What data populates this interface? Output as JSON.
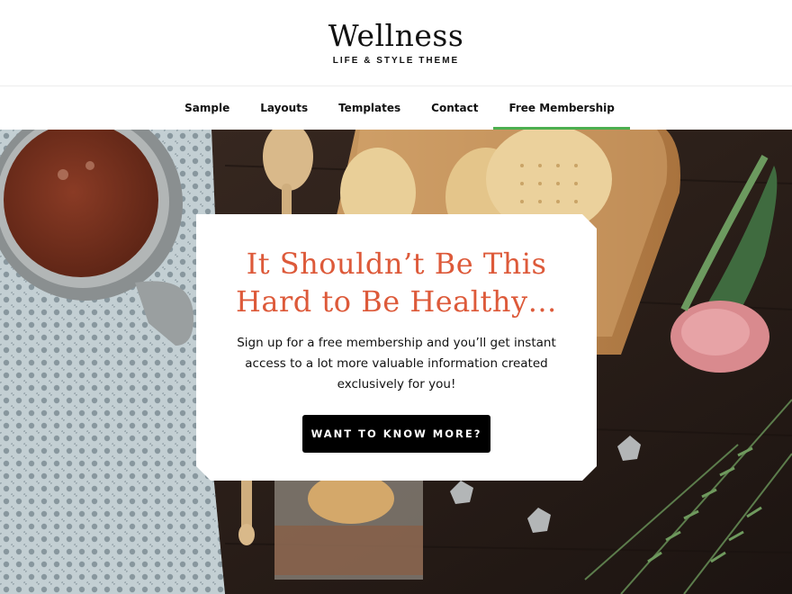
{
  "header": {
    "site_title": "Wellness",
    "tagline": "LIFE & STYLE THEME"
  },
  "nav": {
    "items": [
      {
        "label": "Sample"
      },
      {
        "label": "Layouts"
      },
      {
        "label": "Templates"
      },
      {
        "label": "Contact"
      },
      {
        "label": "Free Membership",
        "active": true
      }
    ],
    "active_color": "#4caf50"
  },
  "hero": {
    "title_line1": "It Shouldn’t Be This",
    "title_line2": "Hard to Be Healthy…",
    "body_line1": "Sign up for a free membership and you’ll get instant",
    "body_line2": "access to a lot more valuable information created",
    "body_line3": "exclusively for you!",
    "cta_label": "WANT TO KNOW MORE?",
    "title_color": "#dd5a3a"
  }
}
